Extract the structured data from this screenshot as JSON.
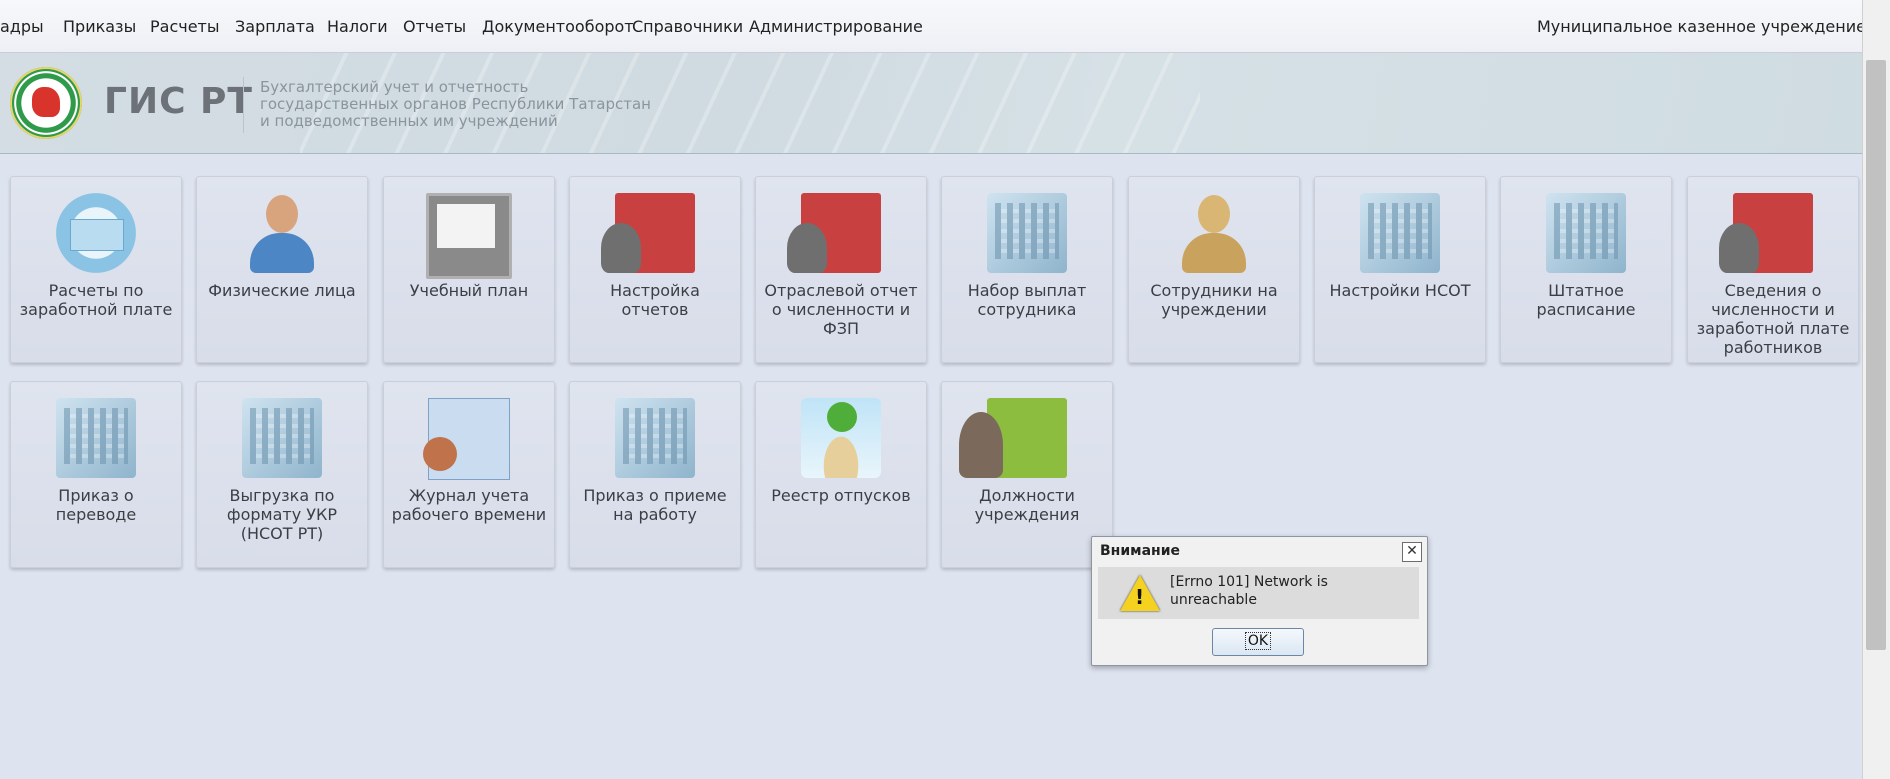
{
  "menu": {
    "items": [
      "адры",
      "Приказы",
      "Расчеты",
      "Зарплата",
      "Налоги",
      "Отчеты",
      "Документооборот",
      "Справочники",
      "Администрирование"
    ],
    "org_name": "Муниципальное казенное учреждение \"Отдел"
  },
  "header": {
    "logo_title": "ГИС РТ",
    "subtitle_lines": [
      "Бухгалтерский учет и отчетность",
      "государственных органов Республики Татарстан",
      "и подведомственных им учреждений"
    ]
  },
  "tiles": [
    {
      "label": "Расчеты по заработной плате",
      "icon": "certificate-icon"
    },
    {
      "label": "Физические лица",
      "icon": "person-icon"
    },
    {
      "label": "Учебный план",
      "icon": "chalkboard-icon"
    },
    {
      "label": "Настройка отчетов",
      "icon": "book-person-icon"
    },
    {
      "label": "Отраслевой отчет о численности и ФЗП",
      "icon": "book-person-icon"
    },
    {
      "label": "Набор выплат сотрудника",
      "icon": "building-icon"
    },
    {
      "label": "Сотрудники на учреждении",
      "icon": "gold-person-icon"
    },
    {
      "label": "Настройки НСОТ",
      "icon": "building-icon"
    },
    {
      "label": "Штатное расписание",
      "icon": "building-icon"
    },
    {
      "label": "Сведения о численности и заработной плате работников",
      "icon": "book-person-icon"
    },
    {
      "label": "Приказ о переводе",
      "icon": "building-icon"
    },
    {
      "label": "Выгрузка по формату УКР (НСОТ РТ)",
      "icon": "building-icon"
    },
    {
      "label": "Журнал учета рабочего времени",
      "icon": "timesheet-icon"
    },
    {
      "label": "Приказ о приеме на работу",
      "icon": "building-icon"
    },
    {
      "label": "Реестр отпусков",
      "icon": "palm-icon"
    },
    {
      "label": "Должности учреждения",
      "icon": "staff-icon"
    }
  ],
  "dialog": {
    "title": "Внимание",
    "message": "[Errno 101] Network is unreachable",
    "ok_label": "OK",
    "close_glyph": "✕"
  }
}
